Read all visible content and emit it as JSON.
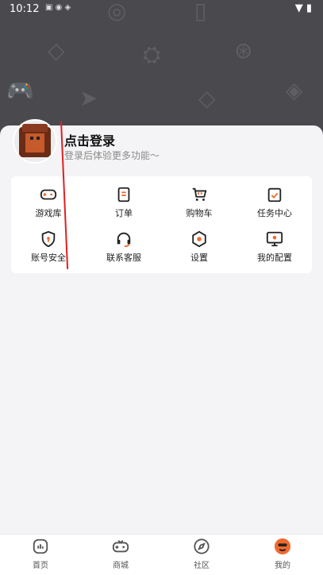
{
  "status_bar": {
    "time": "10:12"
  },
  "profile": {
    "title": "点击登录",
    "subtitle": "登录后体验更多功能～"
  },
  "menu": [
    {
      "label": "游戏库",
      "icon": "gamepad-icon"
    },
    {
      "label": "订单",
      "icon": "order-icon"
    },
    {
      "label": "购物车",
      "icon": "cart-icon"
    },
    {
      "label": "任务中心",
      "icon": "task-icon"
    },
    {
      "label": "账号安全",
      "icon": "shield-icon"
    },
    {
      "label": "联系客服",
      "icon": "headset-icon"
    },
    {
      "label": "设置",
      "icon": "gear-icon"
    },
    {
      "label": "我的配置",
      "icon": "monitor-icon"
    }
  ],
  "tabbar": [
    {
      "label": "首页",
      "icon": "home-icon"
    },
    {
      "label": "商城",
      "icon": "gamepad-icon"
    },
    {
      "label": "社区",
      "icon": "compass-icon"
    },
    {
      "label": "我的",
      "icon": "profile-icon"
    }
  ],
  "colors": {
    "accent": "#f06a2f",
    "hero_bg": "#4a4a4e"
  }
}
